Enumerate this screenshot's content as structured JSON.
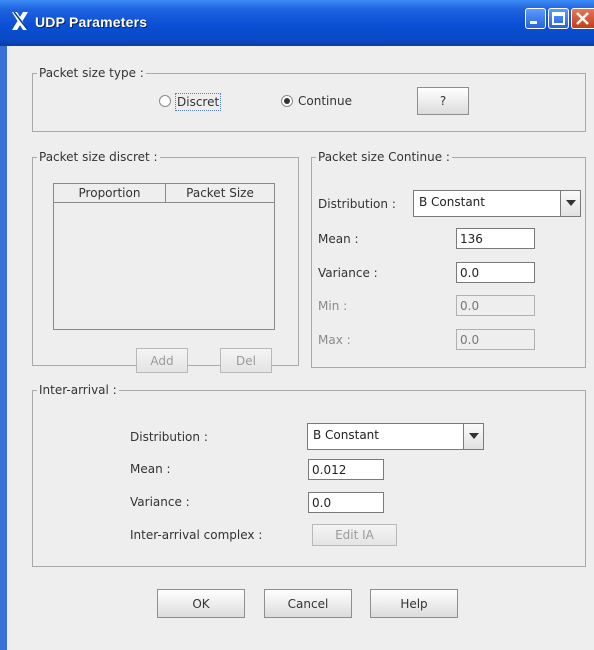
{
  "window": {
    "title": "UDP Parameters",
    "icons": {
      "app": "x-logo-icon",
      "minimize": "minimize-icon",
      "maximize": "maximize-icon",
      "close": "close-icon"
    },
    "colors": {
      "titlebar": "#0a4fd4",
      "client_bg": "#eeeeee",
      "close_button": "#c43c18"
    }
  },
  "packet_size_type": {
    "title": "Packet size type :",
    "options": [
      {
        "label": "Discret",
        "selected": false
      },
      {
        "label": "Continue",
        "selected": true
      }
    ],
    "help_label": "?"
  },
  "packet_size_discret": {
    "title": "Packet size discret :",
    "columns": [
      "Proportion",
      "Packet Size"
    ],
    "rows": [],
    "add_label": "Add",
    "del_label": "Del"
  },
  "packet_size_continue": {
    "title": "Packet size Continue :",
    "distribution_label": "Distribution :",
    "distribution_value": "B  Constant",
    "mean_label": "Mean :",
    "mean_value": "136",
    "variance_label": "Variance :",
    "variance_value": "0.0",
    "min_label": "Min :",
    "min_value": "0.0",
    "max_label": "Max :",
    "max_value": "0.0"
  },
  "inter_arrival": {
    "title": "Inter-arrival :",
    "distribution_label": "Distribution :",
    "distribution_value": "B  Constant",
    "mean_label": "Mean :",
    "mean_value": "0.012",
    "variance_label": "Variance :",
    "variance_value": "0.0",
    "complex_label": "Inter-arrival complex :",
    "edit_label": "Edit IA"
  },
  "footer": {
    "ok_label": "OK",
    "cancel_label": "Cancel",
    "help_label": "Help"
  }
}
